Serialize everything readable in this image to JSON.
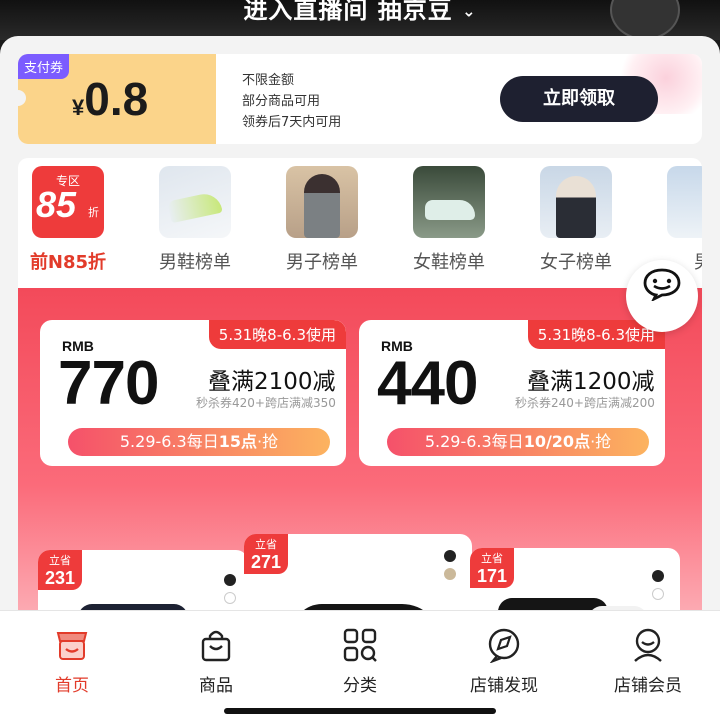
{
  "top": {
    "live_text": "进入直播间 抽京豆",
    "chevron": "⌄"
  },
  "coupon": {
    "tag": "支付券",
    "currency": "¥",
    "amount": "0.8",
    "lines": [
      "不限金额",
      "部分商品可用",
      "领券后7天内可用"
    ],
    "button": "立即领取"
  },
  "categories": [
    {
      "label": "前N85折",
      "icon": "discount-badge",
      "badge_top": "专区",
      "badge_num": "85",
      "badge_unit": "折"
    },
    {
      "label": "男鞋榜单",
      "icon": "men-shoe-image"
    },
    {
      "label": "男子榜单",
      "icon": "men-apparel-image"
    },
    {
      "label": "女鞋榜单",
      "icon": "women-shoe-image"
    },
    {
      "label": "女子榜单",
      "icon": "women-apparel-image"
    },
    {
      "label": "男",
      "icon": "next-category-image"
    }
  ],
  "deals": [
    {
      "currency": "RMB",
      "amount": "770",
      "title": "叠满2100减",
      "sub": "秒杀券420+跨店满减350",
      "date": "5.31晚8-6.3使用",
      "time_pre": "5.29-6.3每日",
      "time_bold": "15点",
      "time_post": "·抢"
    },
    {
      "currency": "RMB",
      "amount": "440",
      "title": "叠满1200减",
      "sub": "秒杀券240+跨店满减200",
      "date": "5.31晚8-6.3使用",
      "time_pre": "5.29-6.3每日",
      "time_bold": "10/20点",
      "time_post": "·抢"
    }
  ],
  "products": [
    {
      "save_label": "立省",
      "save": "231"
    },
    {
      "save_label": "立省",
      "save": "271"
    },
    {
      "save_label": "立省",
      "save": "171"
    }
  ],
  "nav": [
    {
      "label": "首页",
      "icon": "storefront-icon"
    },
    {
      "label": "商品",
      "icon": "shopping-bag-icon"
    },
    {
      "label": "分类",
      "icon": "grid-category-icon"
    },
    {
      "label": "店铺发现",
      "icon": "discover-icon"
    },
    {
      "label": "店铺会员",
      "icon": "member-icon"
    }
  ],
  "colors": {
    "accent": "#e23b2a",
    "brand_red": "#ee3b3b",
    "dark_button": "#1e2030",
    "coupon_gold": "#fbd48a",
    "tag_purple": "#7b5cff"
  }
}
